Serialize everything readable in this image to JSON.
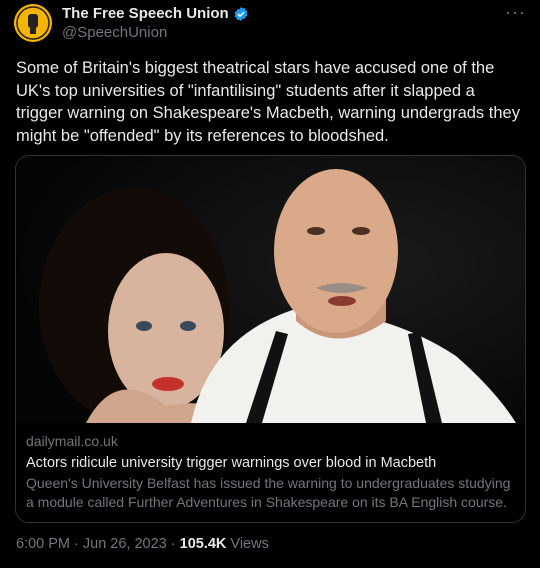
{
  "author": {
    "name": "The Free Speech Union",
    "handle": "@SpeechUnion",
    "avatar_icon": "fist-logo-icon",
    "verified_icon": "verified-badge-icon",
    "verified_color": "#1d9bf0",
    "avatar_color": "#f4b400"
  },
  "tweet": {
    "text": "Some of Britain's biggest theatrical stars have accused one of the UK's top universities of \"infantilising\" students after it slapped a trigger warning on Shakespeare's Macbeth, warning undergrads they might be \"offended\" by its references to bloodshed.",
    "more_icon": "more-options-icon"
  },
  "card": {
    "domain": "dailymail.co.uk",
    "title": "Actors ridicule university trigger warnings over blood in Macbeth",
    "description": "Queen's University Belfast has issued the warning to undergraduates studying a module called Further Adventures in Shakespeare on its BA English course."
  },
  "footer": {
    "time": "6:00 PM · Jun 26, 2023 · ",
    "views_count": "105.4K",
    "views_label": " Views"
  }
}
